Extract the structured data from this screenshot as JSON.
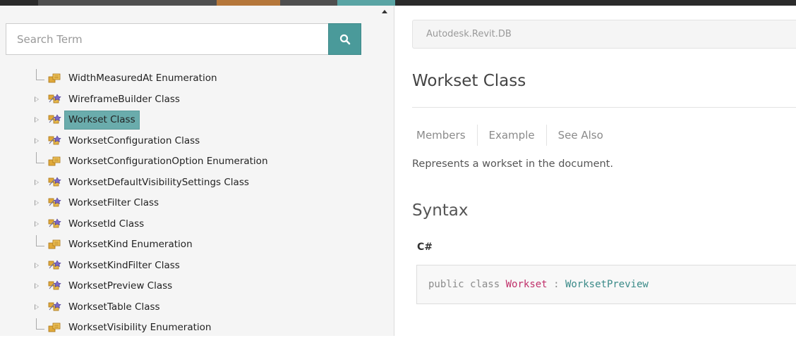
{
  "search": {
    "placeholder": "Search Term"
  },
  "topbar_colors": {
    "dark": "#2b2b2b",
    "gray": "#4f4f4f",
    "orange": "#b5773a",
    "teal": "#5aa4a4"
  },
  "tree": {
    "items": [
      {
        "label": "WidthMeasuredAt Enumeration",
        "kind": "enum-icon",
        "expandable": false
      },
      {
        "label": "WireframeBuilder Class",
        "kind": "class-icon",
        "expandable": true
      },
      {
        "label": "Workset Class",
        "kind": "class-icon",
        "expandable": true,
        "selected": true
      },
      {
        "label": "WorksetConfiguration Class",
        "kind": "class-icon",
        "expandable": true
      },
      {
        "label": "WorksetConfigurationOption Enumeration",
        "kind": "enum-icon",
        "expandable": false
      },
      {
        "label": "WorksetDefaultVisibilitySettings Class",
        "kind": "class-icon",
        "expandable": true
      },
      {
        "label": "WorksetFilter Class",
        "kind": "class-icon",
        "expandable": true
      },
      {
        "label": "WorksetId Class",
        "kind": "class-icon",
        "expandable": true
      },
      {
        "label": "WorksetKind Enumeration",
        "kind": "enum-icon",
        "expandable": false
      },
      {
        "label": "WorksetKindFilter Class",
        "kind": "class-icon",
        "expandable": true
      },
      {
        "label": "WorksetPreview Class",
        "kind": "class-icon",
        "expandable": true
      },
      {
        "label": "WorksetTable Class",
        "kind": "class-icon",
        "expandable": true
      },
      {
        "label": "WorksetVisibility Enumeration",
        "kind": "enum-icon",
        "expandable": false
      }
    ]
  },
  "main": {
    "breadcrumb": "Autodesk.Revit.DB",
    "title": "Workset Class",
    "tabs": [
      {
        "label": "Members"
      },
      {
        "label": "Example"
      },
      {
        "label": "See Also"
      }
    ],
    "summary": "Represents a workset in the document.",
    "syntax": {
      "heading": "Syntax",
      "language": "C#",
      "code": {
        "modifier": "public",
        "keyword": "class",
        "name": "Workset",
        "colon": ":",
        "base": "WorksetPreview"
      }
    }
  }
}
